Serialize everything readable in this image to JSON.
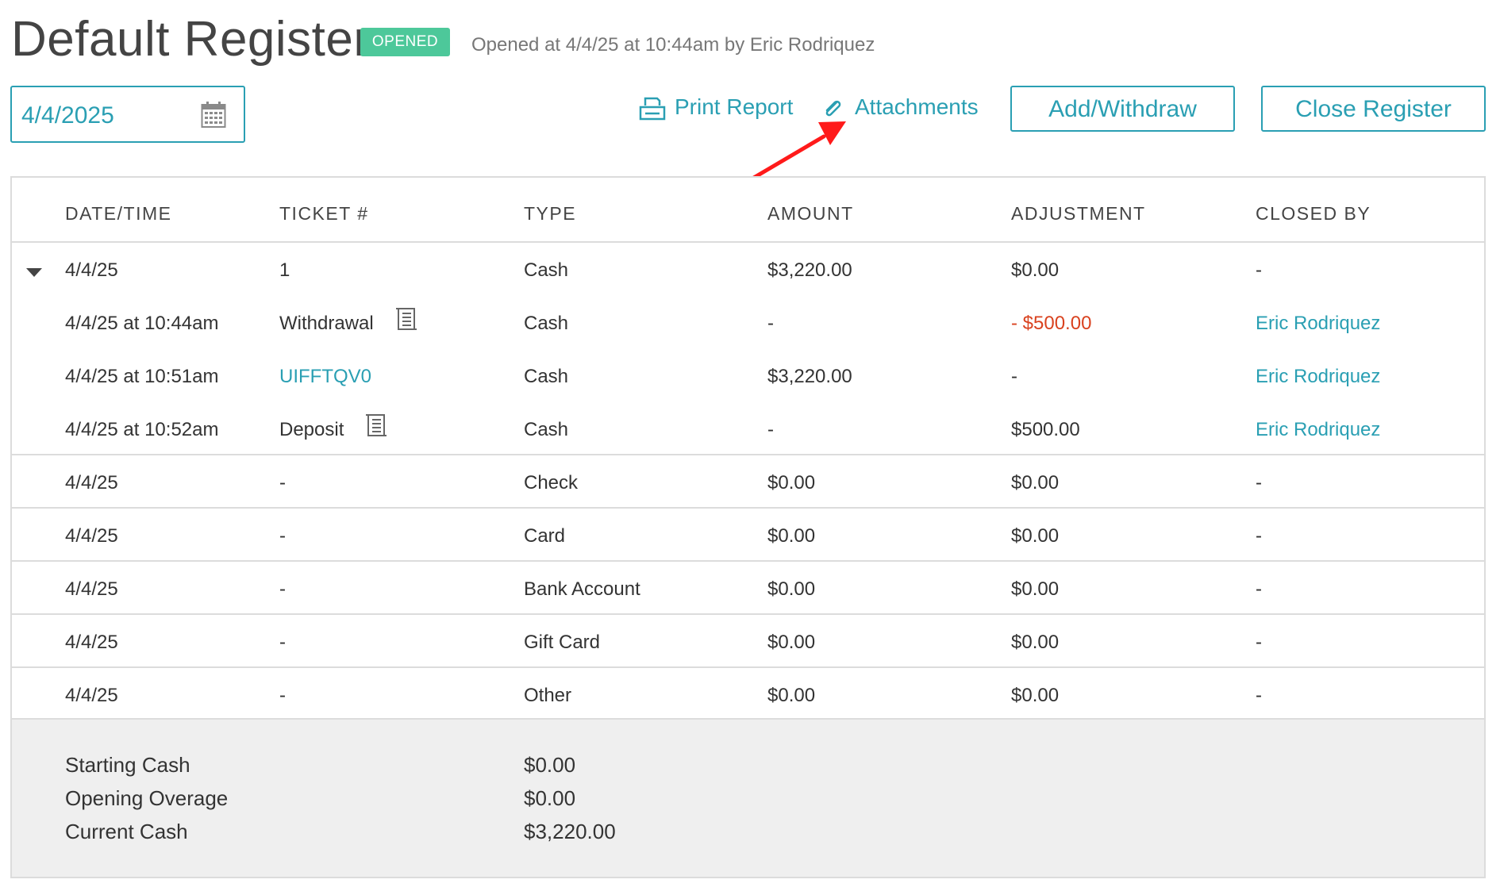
{
  "header": {
    "title": "Default Register",
    "status_badge": "OPENED",
    "opened_info": "Opened at 4/4/25 at 10:44am by Eric Rodriquez"
  },
  "toolbar": {
    "date_value": "4/4/2025",
    "print_report_label": "Print Report",
    "attachments_label": "Attachments",
    "add_withdraw_label": "Add/Withdraw",
    "close_register_label": "Close Register"
  },
  "table": {
    "columns": [
      "DATE/TIME",
      "TICKET #",
      "TYPE",
      "AMOUNT",
      "ADJUSTMENT",
      "CLOSED BY"
    ],
    "cash_group": {
      "date": "4/4/25",
      "ticket": "1",
      "type": "Cash",
      "amount": "$3,220.00",
      "adjustment": "$0.00",
      "closed_by": "-",
      "children": [
        {
          "date": "4/4/25 at 10:44am",
          "ticket": "Withdrawal",
          "type": "Cash",
          "amount": "-",
          "adjustment": "- $500.00",
          "closed_by": "Eric Rodriquez"
        },
        {
          "date": "4/4/25 at 10:51am",
          "ticket": "UIFFTQV0",
          "type": "Cash",
          "amount": "$3,220.00",
          "adjustment": "-",
          "closed_by": "Eric Rodriquez"
        },
        {
          "date": "4/4/25 at 10:52am",
          "ticket": "Deposit",
          "type": "Cash",
          "amount": "-",
          "adjustment": "$500.00",
          "closed_by": "Eric Rodriquez"
        }
      ]
    },
    "rows": [
      {
        "date": "4/4/25",
        "ticket": "-",
        "type": "Check",
        "amount": "$0.00",
        "adjustment": "$0.00",
        "closed_by": "-"
      },
      {
        "date": "4/4/25",
        "ticket": "-",
        "type": "Card",
        "amount": "$0.00",
        "adjustment": "$0.00",
        "closed_by": "-"
      },
      {
        "date": "4/4/25",
        "ticket": "-",
        "type": "Bank Account",
        "amount": "$0.00",
        "adjustment": "$0.00",
        "closed_by": "-"
      },
      {
        "date": "4/4/25",
        "ticket": "-",
        "type": "Gift Card",
        "amount": "$0.00",
        "adjustment": "$0.00",
        "closed_by": "-"
      },
      {
        "date": "4/4/25",
        "ticket": "-",
        "type": "Other",
        "amount": "$0.00",
        "adjustment": "$0.00",
        "closed_by": "-"
      }
    ]
  },
  "summary": [
    {
      "label": "Starting Cash",
      "value": "$0.00"
    },
    {
      "label": "Opening Overage",
      "value": "$0.00"
    },
    {
      "label": "Current Cash",
      "value": "$3,220.00"
    }
  ],
  "colors": {
    "accent": "#2a9fb3",
    "badge": "#4dc89a",
    "negative": "#d9421f",
    "annotation_arrow": "#ff1a1a"
  },
  "icons": [
    "calendar-icon",
    "printer-icon",
    "paperclip-icon",
    "receipt-icon",
    "caret-down-icon"
  ]
}
